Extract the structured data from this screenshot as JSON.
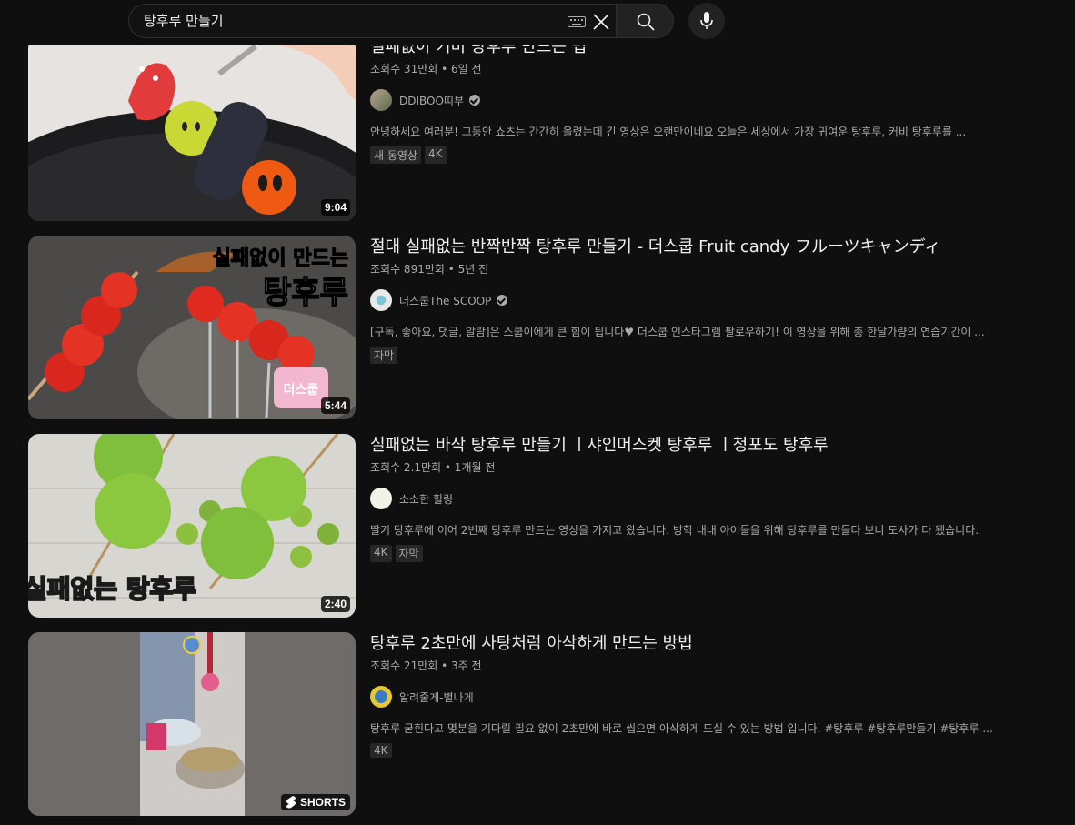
{
  "search": {
    "query": "탕후루 만들기"
  },
  "results": [
    {
      "title": "실패없이 커비 탕후루 만드는 법",
      "meta": "조회수 31만회 • 6일 전",
      "channel": "DDIBOO띠부",
      "verified": true,
      "description": "안녕하세요 여러분! 그동안 쇼츠는 간간히 올렸는데 긴 영상은 오랜만이네요 오늘은 세상에서 가장 귀여운 탕후루, 커비 탕후루를 ...",
      "badges": [
        "새 동영상",
        "4K"
      ],
      "duration": "9:04"
    },
    {
      "title": "절대 실패없는 반짝반짝 탕후루 만들기 - 더스쿱 Fruit candy フルーツキャンディ",
      "meta": "조회수 891만회 • 5년 전",
      "channel": "더스쿱The SCOOP",
      "verified": true,
      "description": "[구독, 좋아요, 댓글, 알람]은 스쿱이에게 큰 힘이 됩니다♥ 더스쿱 인스타그램 팔로우하기! 이 영상을 위해 총 한달가량의 연습기간이 ...",
      "badges": [
        "자막"
      ],
      "duration": "5:44",
      "thumb_text": [
        "실패없이 만드는",
        "탕후루"
      ],
      "thumb_logo": "더스쿱"
    },
    {
      "title": "실패없는 바삭 탕후루 만들기 ㅣ샤인머스켓 탕후루 ㅣ청포도 탕후루",
      "meta": "조회수 2.1만회 • 1개월 전",
      "channel": "소소한 힐링",
      "verified": false,
      "description": "딸기 탕후루에 이어 2번째 탕후루 만드는 영상을 가지고 왔습니다. 방학 내내 아이들을 위해 탕후루를 만들다 보니 도사가 다 됐습니다.",
      "badges": [
        "4K",
        "자막"
      ],
      "duration": "2:40",
      "thumb_text": "실패없는 탕후루"
    },
    {
      "title": "탕후루 2초만에 사탕처럼 아삭하게 만드는 방법",
      "meta": "조회수 21만회 • 3주 전",
      "channel": "알려줄게-별나게",
      "verified": false,
      "description": "탕후루 굳힌다고 몇분을 기다릴 필요 없이 2초만에 바로 씹으면 아삭하게 드실 수 있는 방법 입니다. #탕후루 #탕후루만들기 #탕후루 ...",
      "badges": [
        "4K"
      ],
      "shorts_label": "SHORTS"
    }
  ],
  "colors": {
    "background": "#0f0f0f",
    "primary_text": "#f1f1f1",
    "secondary_text": "#aaaaaa",
    "badge_bg": "#272727"
  }
}
